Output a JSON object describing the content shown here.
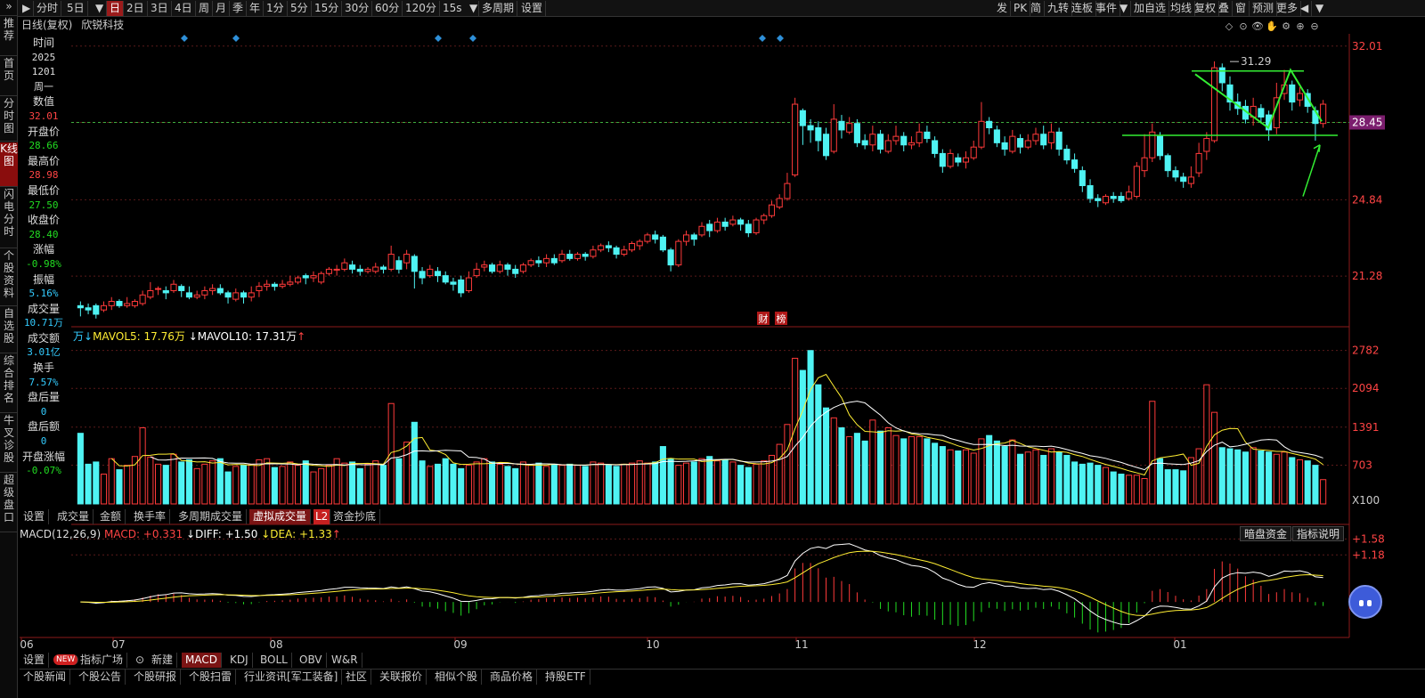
{
  "toolbar": {
    "left": [
      "分时",
      "5日",
      "日",
      "2日",
      "3日",
      "4日",
      "周",
      "月",
      "季",
      "年",
      "1分",
      "5分",
      "15分",
      "30分",
      "60分",
      "120分",
      "15s",
      "多周期",
      "设置"
    ],
    "active": "日",
    "right": [
      "发",
      "PK",
      "简",
      "九转",
      "连板",
      "事件",
      "加自选",
      "均线",
      "复权",
      "叠",
      "窗",
      "预测",
      "更多"
    ]
  },
  "left_sidebar": [
    "推荐",
    "首页",
    "分时图",
    "K线图",
    "闪电分时",
    "个股资料",
    "自选股",
    "综合排名",
    "牛叉诊股",
    "超级盘口"
  ],
  "title": {
    "period": "日线(复权)",
    "stock": "欣锐科技"
  },
  "info_panel": [
    {
      "label": "时间",
      "value": "2025"
    },
    {
      "label": "",
      "value": "1201"
    },
    {
      "label": "",
      "value": "周一"
    },
    {
      "label": "数值",
      "value": "32.01",
      "color": "#ff4444"
    },
    {
      "label": "开盘价",
      "value": "28.66",
      "color": "#22dd22"
    },
    {
      "label": "最高价",
      "value": "28.98",
      "color": "#ff4444"
    },
    {
      "label": "最低价",
      "value": "27.50",
      "color": "#22dd22"
    },
    {
      "label": "收盘价",
      "value": "28.40",
      "color": "#22dd22"
    },
    {
      "label": "涨幅",
      "value": "-0.98%",
      "color": "#22dd22"
    },
    {
      "label": "振幅",
      "value": "5.16%",
      "color": "#33ccff"
    },
    {
      "label": "成交量",
      "value": "10.71万",
      "color": "#33ccff"
    },
    {
      "label": "成交额",
      "value": "3.01亿",
      "color": "#33ccff"
    },
    {
      "label": "换手",
      "value": "7.57%",
      "color": "#33ccff"
    },
    {
      "label": "盘后量",
      "value": "0",
      "color": "#33ccff"
    },
    {
      "label": "盘后额",
      "value": "0",
      "color": "#33ccff"
    },
    {
      "label": "开盘涨幅",
      "value": "-0.07%",
      "color": "#22dd22"
    }
  ],
  "price_axis": [
    "32.01",
    "28.45",
    "24.84",
    "21.28"
  ],
  "price_annotation": "31.29",
  "markers": [
    "财",
    "榜"
  ],
  "volume": {
    "legend_unit": "万",
    "mavol5": "MAVOL5: 17.76万",
    "mavol10": "MAVOL10: 17.31万",
    "axis": [
      "2782",
      "2094",
      "1391",
      "703"
    ],
    "scale": "X100"
  },
  "vol_tabs": [
    "设置",
    "成交量",
    "金额",
    "换手率",
    "多周期成交量",
    "虚拟成交量",
    "L2",
    "资金抄底"
  ],
  "macd": {
    "title": "MACD(12,26,9)",
    "macd": "MACD: +0.331",
    "diff": "DIFF: +1.50",
    "dea": "DEA: +1.33",
    "axis": [
      "+1.58",
      "+1.18"
    ],
    "buttons": [
      "暗盘资金",
      "指标说明"
    ]
  },
  "months": [
    "06",
    "07",
    "08",
    "09",
    "10",
    "11",
    "12",
    "01"
  ],
  "indicator_tabs": [
    "设置",
    "NEW",
    "指标广场",
    "新建",
    "MACD",
    "KDJ",
    "BOLL",
    "OBV",
    "W&R"
  ],
  "bottom_tabs": [
    "个股新闻",
    "个股公告",
    "个股研报",
    "个股扫雷",
    "行业资讯[军工装备]",
    "社区",
    "关联报价",
    "相似个股",
    "商品价格",
    "持股ETF"
  ],
  "chart_data": {
    "type": "candlestick",
    "ylim": [
      19.0,
      32.5
    ],
    "candles": [
      [
        19.9,
        19.8,
        20.1,
        19.4
      ],
      [
        19.8,
        19.7,
        20.0,
        19.5
      ],
      [
        19.9,
        19.5,
        20.0,
        19.3
      ],
      [
        19.7,
        19.9,
        20.1,
        19.6
      ],
      [
        19.9,
        20.1,
        20.3,
        19.7
      ],
      [
        20.1,
        19.9,
        20.2,
        19.8
      ],
      [
        19.9,
        20.0,
        20.3,
        19.8
      ],
      [
        19.9,
        20.1,
        20.2,
        19.8
      ],
      [
        20.0,
        20.4,
        20.6,
        19.9
      ],
      [
        20.3,
        20.6,
        21.0,
        20.2
      ],
      [
        20.7,
        20.7,
        20.8,
        20.4
      ],
      [
        20.6,
        20.5,
        20.8,
        20.2
      ],
      [
        20.6,
        20.9,
        21.1,
        20.5
      ],
      [
        20.8,
        20.6,
        20.9,
        20.3
      ],
      [
        20.5,
        20.3,
        20.8,
        20.2
      ],
      [
        20.3,
        20.4,
        20.6,
        20.2
      ],
      [
        20.4,
        20.6,
        20.8,
        20.2
      ],
      [
        20.6,
        20.7,
        20.9,
        20.4
      ],
      [
        20.7,
        20.5,
        20.9,
        20.4
      ],
      [
        20.5,
        20.3,
        20.6,
        20.0
      ],
      [
        20.2,
        20.5,
        20.7,
        20.1
      ],
      [
        20.5,
        20.3,
        20.6,
        20.0
      ],
      [
        20.3,
        20.5,
        20.8,
        20.1
      ],
      [
        20.6,
        20.8,
        21.0,
        20.3
      ],
      [
        20.8,
        20.9,
        21.1,
        20.6
      ],
      [
        20.9,
        20.8,
        21.0,
        20.6
      ],
      [
        20.8,
        20.9,
        21.1,
        20.7
      ],
      [
        20.9,
        21.0,
        21.3,
        20.8
      ],
      [
        21.0,
        21.2,
        21.3,
        20.9
      ],
      [
        21.3,
        21.2,
        21.4,
        20.9
      ],
      [
        21.2,
        21.3,
        21.5,
        21.0
      ],
      [
        21.0,
        21.4,
        21.5,
        20.9
      ],
      [
        21.4,
        21.6,
        21.7,
        21.3
      ],
      [
        21.6,
        21.6,
        21.8,
        21.3
      ],
      [
        21.6,
        21.9,
        22.1,
        21.5
      ],
      [
        21.8,
        21.6,
        22.0,
        21.4
      ],
      [
        21.6,
        21.5,
        21.8,
        21.3
      ],
      [
        21.5,
        21.6,
        21.7,
        21.4
      ],
      [
        21.5,
        21.7,
        21.9,
        21.4
      ],
      [
        21.7,
        21.6,
        21.8,
        21.4
      ],
      [
        21.6,
        22.3,
        22.7,
        21.5
      ],
      [
        22.0,
        21.6,
        22.2,
        21.4
      ],
      [
        21.9,
        22.3,
        22.5,
        21.6
      ],
      [
        22.2,
        21.5,
        22.3,
        20.7
      ],
      [
        21.5,
        21.2,
        21.7,
        20.9
      ],
      [
        21.3,
        21.6,
        21.8,
        21.2
      ],
      [
        21.5,
        21.3,
        21.7,
        21.0
      ],
      [
        21.3,
        21.0,
        21.5,
        20.9
      ],
      [
        21.0,
        20.9,
        21.2,
        20.6
      ],
      [
        21.1,
        20.5,
        21.3,
        20.3
      ],
      [
        20.6,
        21.2,
        21.5,
        20.5
      ],
      [
        21.3,
        21.6,
        21.9,
        21.2
      ],
      [
        21.7,
        21.8,
        22.0,
        21.5
      ],
      [
        21.8,
        21.5,
        21.9,
        21.4
      ],
      [
        21.5,
        21.8,
        22.0,
        21.4
      ],
      [
        21.8,
        21.6,
        21.9,
        21.3
      ],
      [
        21.6,
        21.4,
        21.8,
        21.2
      ],
      [
        21.5,
        21.8,
        21.9,
        21.4
      ],
      [
        21.8,
        22.0,
        22.1,
        21.7
      ],
      [
        22.0,
        21.9,
        22.2,
        21.7
      ],
      [
        21.9,
        22.1,
        22.3,
        21.7
      ],
      [
        22.1,
        21.9,
        22.3,
        21.8
      ],
      [
        22.0,
        22.3,
        22.5,
        21.9
      ],
      [
        22.3,
        22.1,
        22.5,
        22.0
      ],
      [
        22.1,
        22.3,
        22.4,
        22.0
      ],
      [
        22.3,
        22.2,
        22.4,
        22.0
      ],
      [
        22.2,
        22.5,
        22.7,
        22.1
      ],
      [
        22.5,
        22.7,
        22.8,
        22.4
      ],
      [
        22.7,
        22.6,
        22.9,
        22.4
      ],
      [
        22.6,
        22.3,
        22.7,
        22.1
      ],
      [
        22.3,
        22.5,
        22.7,
        22.2
      ],
      [
        22.5,
        22.8,
        22.9,
        22.4
      ],
      [
        22.7,
        22.9,
        23.0,
        22.5
      ],
      [
        22.9,
        23.2,
        23.3,
        22.8
      ],
      [
        23.2,
        23.0,
        23.4,
        22.8
      ],
      [
        23.1,
        22.5,
        23.2,
        22.4
      ],
      [
        22.5,
        21.8,
        22.6,
        21.5
      ],
      [
        21.8,
        22.9,
        23.0,
        21.7
      ],
      [
        22.9,
        23.2,
        23.4,
        22.7
      ],
      [
        23.2,
        23.0,
        23.3,
        22.7
      ],
      [
        23.2,
        23.6,
        23.8,
        23.1
      ],
      [
        23.7,
        23.4,
        23.9,
        23.1
      ],
      [
        23.4,
        23.8,
        24.0,
        23.3
      ],
      [
        23.8,
        23.6,
        24.0,
        23.4
      ],
      [
        23.7,
        23.9,
        24.1,
        23.6
      ],
      [
        23.9,
        23.7,
        24.0,
        23.4
      ],
      [
        23.7,
        23.3,
        23.9,
        23.1
      ],
      [
        23.3,
        23.9,
        24.0,
        23.2
      ],
      [
        23.9,
        24.1,
        24.2,
        23.7
      ],
      [
        24.1,
        24.6,
        24.8,
        24.0
      ],
      [
        24.5,
        24.9,
        25.1,
        24.4
      ],
      [
        24.9,
        25.6,
        26.1,
        24.8
      ],
      [
        26.0,
        29.3,
        29.6,
        25.9
      ],
      [
        29.0,
        28.3,
        29.1,
        27.4
      ],
      [
        28.3,
        28.1,
        28.6,
        27.5
      ],
      [
        28.2,
        27.6,
        28.5,
        27.1
      ],
      [
        27.9,
        26.9,
        28.2,
        26.7
      ],
      [
        27.1,
        28.6,
        29.3,
        27.0
      ],
      [
        28.5,
        28.1,
        28.8,
        27.7
      ],
      [
        28.0,
        28.4,
        28.7,
        27.9
      ],
      [
        28.4,
        27.5,
        28.6,
        27.3
      ],
      [
        27.6,
        27.4,
        27.9,
        27.2
      ],
      [
        27.4,
        27.9,
        28.3,
        27.1
      ],
      [
        27.9,
        27.2,
        28.1,
        27.0
      ],
      [
        27.1,
        27.6,
        27.9,
        27.0
      ],
      [
        27.6,
        27.8,
        28.3,
        27.4
      ],
      [
        27.8,
        27.4,
        28.0,
        27.1
      ],
      [
        27.4,
        27.5,
        27.8,
        27.2
      ],
      [
        27.5,
        28.0,
        28.4,
        27.3
      ],
      [
        28.0,
        27.7,
        28.3,
        27.5
      ],
      [
        27.6,
        27.0,
        27.8,
        26.8
      ],
      [
        27.0,
        26.4,
        27.2,
        26.1
      ],
      [
        26.4,
        27.0,
        27.2,
        26.3
      ],
      [
        26.8,
        26.6,
        27.0,
        26.4
      ],
      [
        26.6,
        26.8,
        27.1,
        26.3
      ],
      [
        26.8,
        27.3,
        27.6,
        26.7
      ],
      [
        27.3,
        28.5,
        29.4,
        27.2
      ],
      [
        28.5,
        28.2,
        28.7,
        27.9
      ],
      [
        28.1,
        27.5,
        28.3,
        27.3
      ],
      [
        27.5,
        27.2,
        27.8,
        26.9
      ],
      [
        27.1,
        27.8,
        28.1,
        27.0
      ],
      [
        27.7,
        27.3,
        27.9,
        27.0
      ],
      [
        27.3,
        27.6,
        27.9,
        27.2
      ],
      [
        27.6,
        27.9,
        28.2,
        27.4
      ],
      [
        27.9,
        27.4,
        28.3,
        27.2
      ],
      [
        27.5,
        28.0,
        28.4,
        27.2
      ],
      [
        28.0,
        27.2,
        28.2,
        26.9
      ],
      [
        27.2,
        26.7,
        27.4,
        26.5
      ],
      [
        26.7,
        26.3,
        27.0,
        26.1
      ],
      [
        26.2,
        25.5,
        26.4,
        25.2
      ],
      [
        25.5,
        24.9,
        25.8,
        24.7
      ],
      [
        24.9,
        24.8,
        25.1,
        24.5
      ],
      [
        24.7,
        25.0,
        25.1,
        24.6
      ],
      [
        25.0,
        24.9,
        25.2,
        24.7
      ],
      [
        25.0,
        24.8,
        25.2,
        24.7
      ],
      [
        24.9,
        25.2,
        25.5,
        24.8
      ],
      [
        25.0,
        26.4,
        26.6,
        24.9
      ],
      [
        26.2,
        26.8,
        27.9,
        25.9
      ],
      [
        26.8,
        28.0,
        28.4,
        26.6
      ],
      [
        27.8,
        26.9,
        28.0,
        26.7
      ],
      [
        26.9,
        26.2,
        27.0,
        25.9
      ],
      [
        26.2,
        25.9,
        26.4,
        25.7
      ],
      [
        25.9,
        25.7,
        26.1,
        25.4
      ],
      [
        25.6,
        25.9,
        26.4,
        25.4
      ],
      [
        26.1,
        27.0,
        27.5,
        25.9
      ],
      [
        27.1,
        27.7,
        28.0,
        26.7
      ],
      [
        27.6,
        31.0,
        31.3,
        27.5
      ],
      [
        31.0,
        30.3,
        31.2,
        29.9
      ],
      [
        30.2,
        29.4,
        30.6,
        29.0
      ],
      [
        29.4,
        29.1,
        29.8,
        28.8
      ],
      [
        29.2,
        28.6,
        29.5,
        28.4
      ],
      [
        28.7,
        29.2,
        29.6,
        28.3
      ],
      [
        29.1,
        28.7,
        29.3,
        28.4
      ],
      [
        28.8,
        28.1,
        29.0,
        27.6
      ],
      [
        28.2,
        29.6,
        30.3,
        27.9
      ],
      [
        29.8,
        30.2,
        30.9,
        29.5
      ],
      [
        30.2,
        29.4,
        30.4,
        29.0
      ],
      [
        29.5,
        29.8,
        30.1,
        29.2
      ],
      [
        29.8,
        29.2,
        30.0,
        28.9
      ],
      [
        29.0,
        28.4,
        29.2,
        27.6
      ],
      [
        28.4,
        29.3,
        29.5,
        28.2
      ]
    ],
    "volumes": [
      1280,
      720,
      760,
      540,
      820,
      620,
      700,
      860,
      1380,
      850,
      720,
      700,
      900,
      760,
      800,
      640,
      720,
      780,
      820,
      580,
      680,
      700,
      720,
      800,
      820,
      660,
      680,
      760,
      700,
      780,
      580,
      640,
      700,
      820,
      740,
      760,
      640,
      720,
      780,
      700,
      1820,
      820,
      1120,
      1480,
      780,
      680,
      720,
      820,
      720,
      640,
      700,
      760,
      820,
      760,
      720,
      680,
      640,
      760,
      700,
      740,
      680,
      720,
      700,
      720,
      700,
      680,
      760,
      740,
      700,
      680,
      720,
      740,
      780,
      740,
      760,
      1040,
      820,
      700,
      740,
      760,
      820,
      860,
      780,
      800,
      760,
      700,
      660,
      720,
      780,
      880,
      1080,
      1440,
      2640,
      2420,
      2780,
      2160,
      1740,
      1560,
      1380,
      1220,
      1280,
      1140,
      1520,
      1320,
      1380,
      1240,
      1180,
      1220,
      1220,
      1180,
      1100,
      1040,
      980,
      960,
      980,
      920,
      1180,
      1240,
      1140,
      1040,
      1160,
      900,
      940,
      980,
      880,
      1000,
      940,
      880,
      760,
      720,
      740,
      700,
      660,
      580,
      540,
      520,
      520,
      460,
      1860,
      820,
      620,
      620,
      600,
      840,
      1000,
      2160,
      1660,
      1020,
      1000,
      980,
      940,
      1020,
      960,
      940,
      900,
      940,
      840,
      800,
      780,
      700,
      440
    ],
    "volume_colors_note": "red outline = up day, cyan fill = down day",
    "macd_ylim": [
      -0.8,
      1.7
    ]
  }
}
